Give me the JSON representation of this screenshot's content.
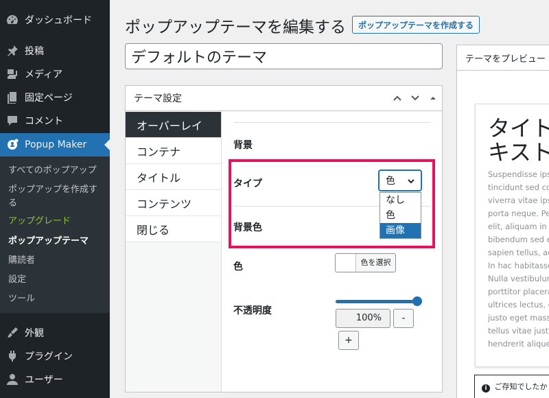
{
  "sidebar": {
    "items": [
      {
        "label": "ダッシュボード",
        "icon": "dashboard-icon"
      },
      {
        "label": "投稿",
        "icon": "pin-icon"
      },
      {
        "label": "メディア",
        "icon": "media-icon"
      },
      {
        "label": "固定ページ",
        "icon": "pages-icon"
      },
      {
        "label": "コメント",
        "icon": "comment-icon"
      },
      {
        "label": "Popup Maker",
        "icon": "popup-maker-icon"
      },
      {
        "label": "外観",
        "icon": "appearance-icon"
      },
      {
        "label": "プラグイン",
        "icon": "plugin-icon"
      },
      {
        "label": "ユーザー",
        "icon": "user-icon"
      }
    ],
    "submenu": [
      "すべてのポップアップ",
      "ポップアップを作成する",
      "アップグレード",
      "ポップアップテーマ",
      "購読者",
      "設定",
      "ツール"
    ],
    "accent_color": "#2271b1",
    "upgrade_color": "#8dc63f"
  },
  "header": {
    "title": "ポップアップテーマを編集する",
    "create_button": "ポップアップテーマを作成する"
  },
  "theme_title_input": {
    "value": "デフォルトのテーマ"
  },
  "settings": {
    "title": "テーマ設定",
    "tabs": [
      "オーバーレイ",
      "コンテナ",
      "タイトル",
      "コンテンツ",
      "閉じる"
    ],
    "active_tab": "オーバーレイ",
    "background_heading": "背景",
    "type_label": "タイプ",
    "type_selected": "色",
    "type_options": [
      "なし",
      "色",
      "画像"
    ],
    "type_highlighted_option": "画像",
    "bg_color_label": "背景色",
    "color_label": "色",
    "color_picker_label": "色を選択",
    "opacity_label": "不透明度",
    "opacity_value": "100%",
    "opacity_fraction": 1.0,
    "minus_label": "-",
    "plus_label": "+",
    "highlight_color": "#e5125e"
  },
  "preview": {
    "header": "テーマをプレビュー",
    "popup_title": "タイト\nキスト",
    "popup_body": "Suspendisse ips\ntincidunt sed co\nviverra vitae ips\nporta neque. Pe\nelit, aliquam in u\nbibendum sed e\nsapien tellus, ac\nIn hac habitasse\nNulla vestibulum\nporttitor placera\nultrices lectus, e\njusto eget mass\ntellus vitae just\nhendrerit aliquet",
    "notice": "ご存知でしたか"
  }
}
